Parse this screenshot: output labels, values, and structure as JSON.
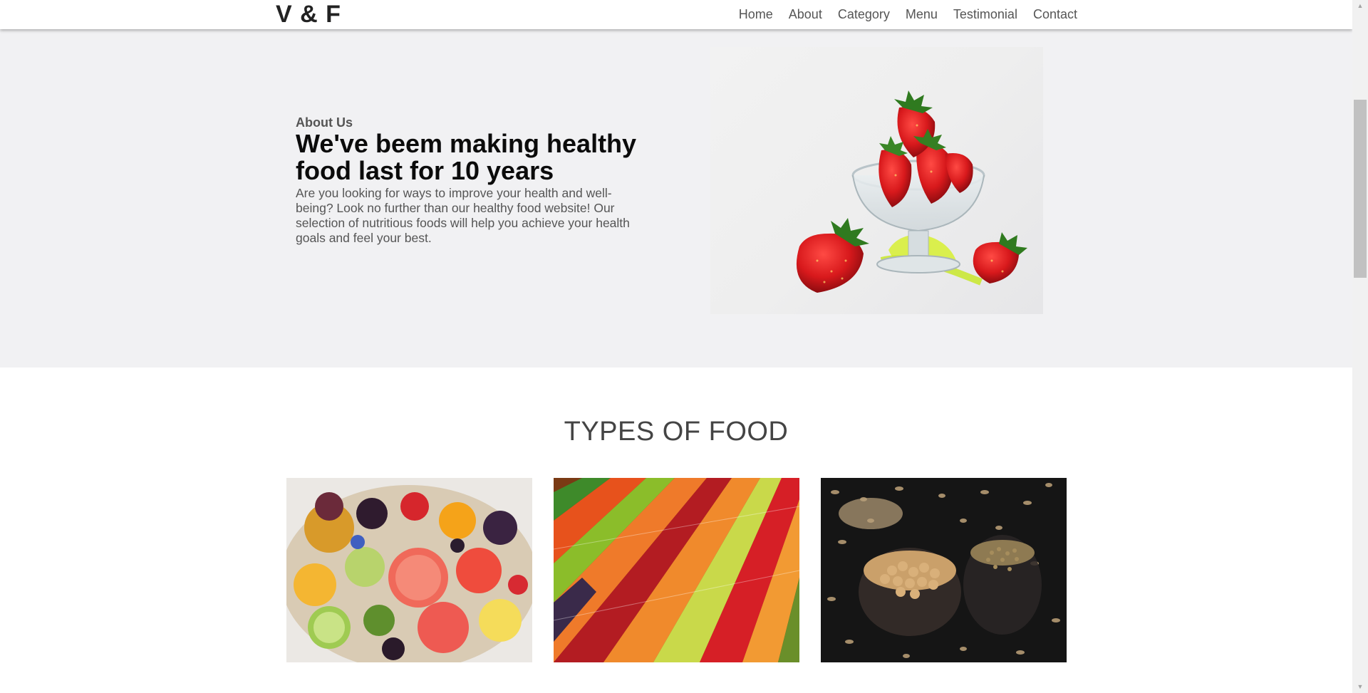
{
  "brand": "V & F",
  "nav": [
    {
      "label": "Home"
    },
    {
      "label": "About"
    },
    {
      "label": "Category"
    },
    {
      "label": "Menu"
    },
    {
      "label": "Testimonial"
    },
    {
      "label": "Contact"
    }
  ],
  "about": {
    "kicker": "About Us",
    "heading": "We've beem making healthy food last for 10 years",
    "body": "Are you looking for ways to improve your health and well-being? Look no further than our healthy food website! Our selection of nutritious foods will help you achieve your health goals and feel your best.",
    "image_icon": "strawberry-bowl-image"
  },
  "types": {
    "title": "TYPES OF FOOD",
    "cards": [
      {
        "image_icon": "fruit-platter-image"
      },
      {
        "image_icon": "vegetable-rows-image"
      },
      {
        "image_icon": "grains-legumes-image"
      }
    ]
  },
  "colors": {
    "about_bg": "#f1f1f3",
    "text_dark": "#0b0b0b",
    "text_muted": "#555555"
  }
}
